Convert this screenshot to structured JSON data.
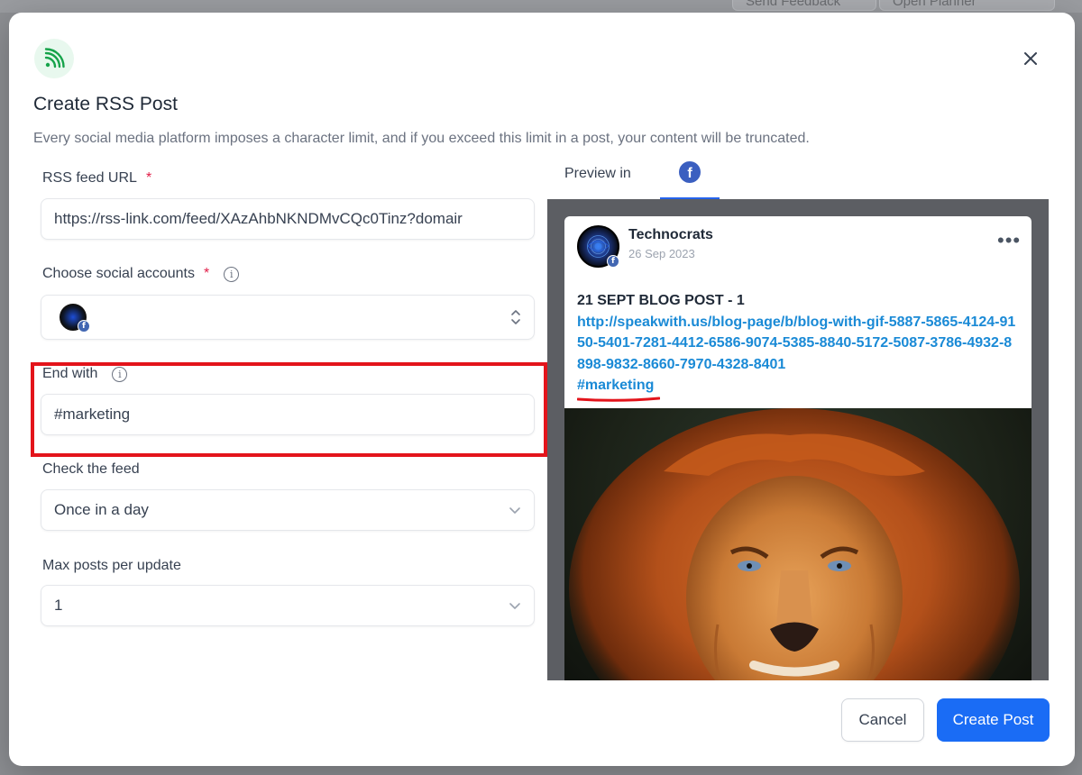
{
  "background": {
    "feedback_button": "Send Feedback",
    "planner_button": "Open Planner"
  },
  "modal": {
    "title": "Create RSS Post",
    "subtitle": "Every social media platform imposes a character limit, and if you exceed this limit in a post, your content will be truncated.",
    "icon": "rss-icon",
    "close_icon": "close-icon"
  },
  "form": {
    "rss_url": {
      "label": "RSS feed URL",
      "required_mark": "*",
      "value": "https://rss-link.com/feed/XAzAhbNKNDMvCQc0Tinz?domair"
    },
    "social_accounts": {
      "label": "Choose social accounts",
      "required_mark": "*",
      "info_icon": "info-icon",
      "selected_account_badge": "f"
    },
    "end_with": {
      "label": "End with",
      "info_icon": "info-icon",
      "value": "#marketing"
    },
    "check_feed": {
      "label": "Check the feed",
      "value": "Once in a day"
    },
    "max_posts": {
      "label": "Max posts per update",
      "value": "1"
    }
  },
  "preview": {
    "tab_label": "Preview in",
    "active_platform": "facebook",
    "fb_glyph": "f",
    "post": {
      "page_name": "Technocrats",
      "date": "26 Sep 2023",
      "more": "•••",
      "title": "21 SEPT BLOG POST - 1",
      "link": "http://speakwith.us/blog-page/b/blog-with-gif-5887-5865-4124-9150-5401-7281-4412-6586-9074-5385-8840-5172-5087-3786-4932-8898-9832-8660-7970-4328-8401",
      "hashtag": "#marketing",
      "image": "lion-photo"
    }
  },
  "actions": {
    "cancel": "Cancel",
    "create": "Create Post"
  },
  "colors": {
    "primary": "#1a6cf5",
    "highlight": "#e3141b",
    "link": "#1a8ad6",
    "rss_green": "#16a34a",
    "facebook": "#3b5fc0"
  }
}
